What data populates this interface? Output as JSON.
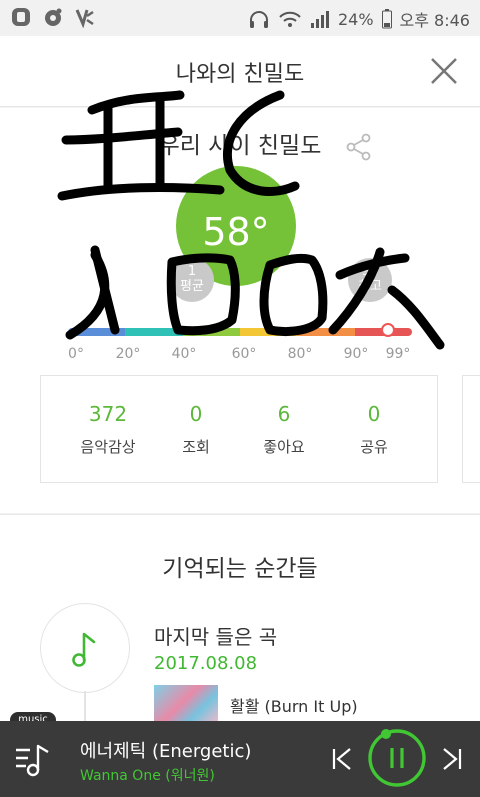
{
  "status": {
    "battery": "24%",
    "time": "오후 8:46",
    "icons": [
      "status-app-icon-1",
      "status-app-icon-2",
      "status-app-icon-3",
      "headphones-icon",
      "wifi-icon",
      "signal-icon",
      "battery-icon"
    ]
  },
  "header": {
    "title": "나와의 친밀도",
    "close_icon": "close-icon"
  },
  "affinity": {
    "subtitle": "우리 사이 친밀도",
    "value": "58°",
    "avg_value": "1",
    "avg_label": "평균",
    "max_value": "93",
    "max_label": "최고",
    "gauge_ticks": [
      "0°",
      "20°",
      "40°",
      "60°",
      "80°",
      "90°",
      "99°"
    ],
    "gauge_colors": [
      "#5b8ed8",
      "#2fc0b6",
      "#8fca3e",
      "#f2c635",
      "#f28f45",
      "#e55555"
    ],
    "gauge_level": 0.93
  },
  "stats": [
    {
      "value": "372",
      "label": "음악감상"
    },
    {
      "value": "0",
      "label": "조회"
    },
    {
      "value": "6",
      "label": "좋아요"
    },
    {
      "value": "0",
      "label": "공유"
    }
  ],
  "moments": {
    "heading": "기억되는 순간들",
    "item_title": "마지막 들은 곡",
    "item_date": "2017.08.08",
    "song": "활활 (Burn It Up)"
  },
  "player": {
    "tag": "music",
    "title": "에너제틱 (Energetic)",
    "artist": "Wanna One (워너원)",
    "accent": "#41c733"
  }
}
